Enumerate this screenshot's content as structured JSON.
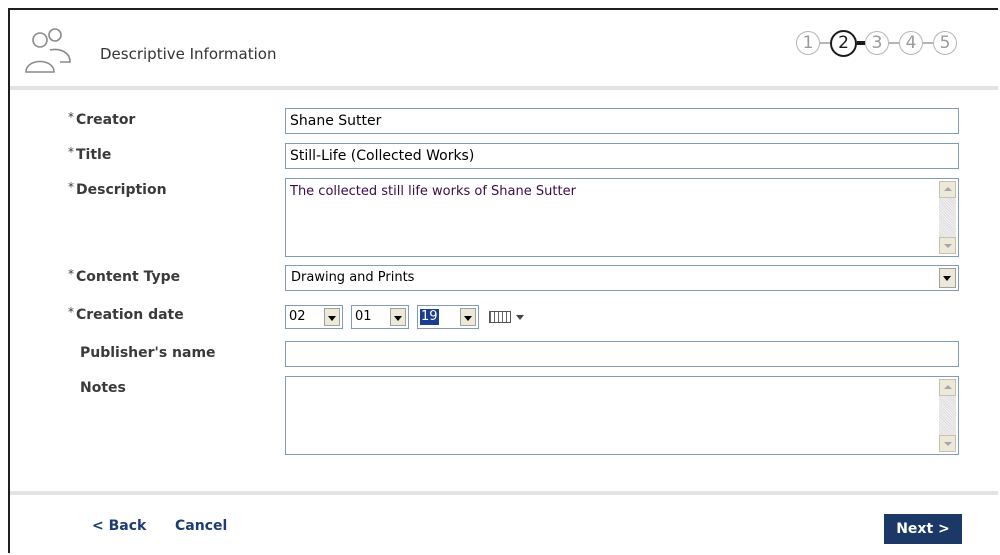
{
  "header": {
    "title": "Descriptive Information",
    "icon": "users-icon",
    "steps": [
      {
        "label": "1",
        "active": false
      },
      {
        "label": "2",
        "active": true
      },
      {
        "label": "3",
        "active": false
      },
      {
        "label": "4",
        "active": false
      },
      {
        "label": "5",
        "active": false
      }
    ]
  },
  "form": {
    "required_marker": "*",
    "creator": {
      "label": "Creator",
      "value": "Shane Sutter"
    },
    "title": {
      "label": "Title",
      "value": "Still-Life (Collected Works)"
    },
    "description": {
      "label": "Description",
      "value": "The collected still life works of Shane Sutter"
    },
    "content_type": {
      "label": "Content Type",
      "value": "Drawing and Prints"
    },
    "creation_date": {
      "label": "Creation date",
      "month": "02",
      "day": "01",
      "year": "19",
      "calendar_icon": "calendar-icon"
    },
    "publisher_name": {
      "label": "Publisher's name",
      "value": ""
    },
    "notes": {
      "label": "Notes",
      "value": ""
    }
  },
  "footer": {
    "back_label": "< Back",
    "cancel_label": "Cancel",
    "next_label": "Next >"
  },
  "colors": {
    "link": "#1c3c72",
    "next_button": "#1b3866",
    "selection": "#1a3d8f"
  }
}
